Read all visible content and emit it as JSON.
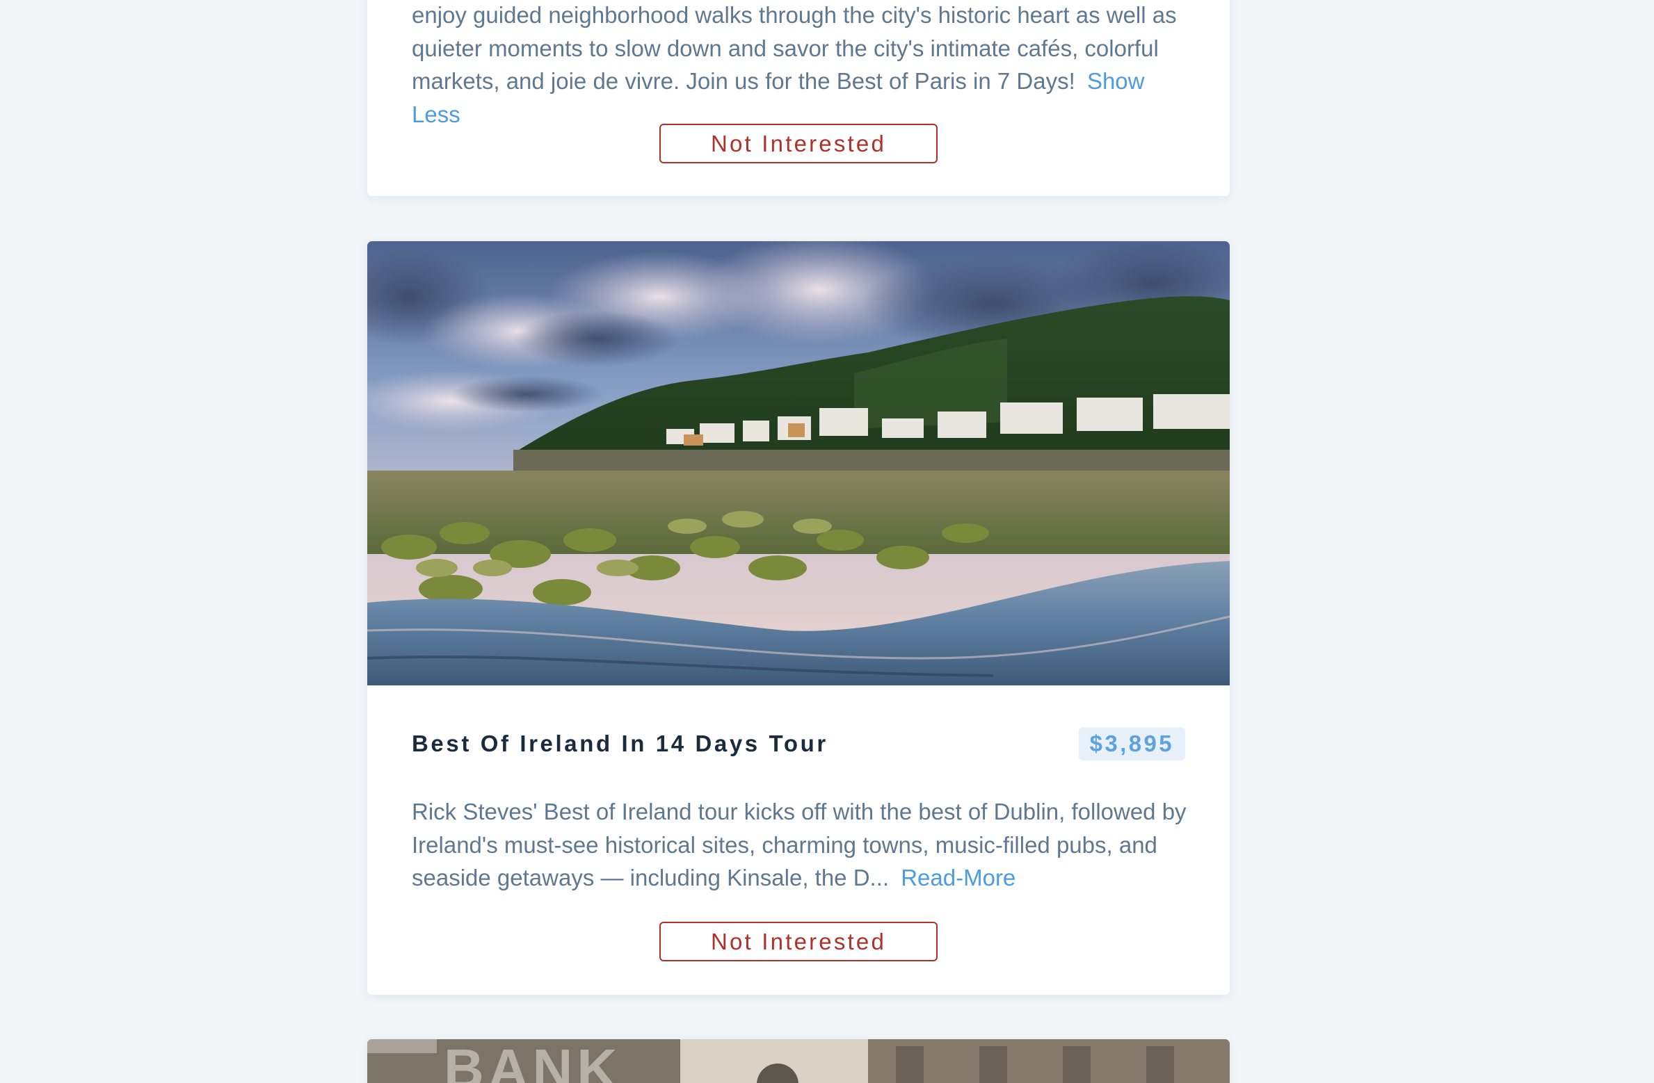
{
  "cards": [
    {
      "description": "enjoy guided neighborhood walks through the city's historic heart as well as quieter moments to slow down and savor the city's intimate cafés, colorful markets, and joie de vivre. Join us for the Best of Paris in 7 Days!",
      "toggle_label": "Show Less",
      "dismiss_label": "Not Interested"
    },
    {
      "title": "Best Of Ireland In 14 Days Tour",
      "price": "$3,895",
      "description": "Rick Steves' Best of Ireland tour kicks off with the best of Dublin, followed by Ireland's must-see historical sites, charming towns, music-filled pubs, and seaside getaways — including Kinsale, the D...",
      "toggle_label": "Read-More",
      "dismiss_label": "Not Interested",
      "image": "coastal-village-photo"
    },
    {
      "image": "city-bank-building-photo",
      "image_sign_text": "BANK"
    }
  ],
  "colors": {
    "background": "#f1f5f8",
    "card": "#ffffff",
    "body_text": "#5f7891",
    "title_text": "#1b2b3f",
    "link": "#4d9be0",
    "price_text": "#5ea3de",
    "price_bg": "#e8f1fa",
    "danger": "#b0302a"
  }
}
